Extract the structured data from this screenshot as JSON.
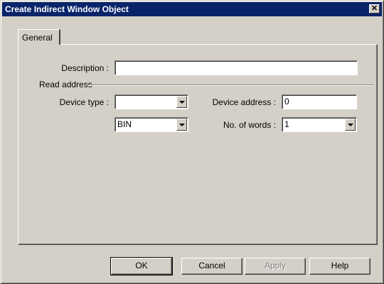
{
  "window": {
    "title": "Create Indirect Window Object",
    "close_glyph": "✕"
  },
  "tabs": [
    {
      "label": "General",
      "active": true
    }
  ],
  "form": {
    "description": {
      "label": "Description :",
      "value": ""
    },
    "read_address_group": "Read address",
    "device_type": {
      "label": "Device type :",
      "value": ""
    },
    "data_format": {
      "value": "BIN"
    },
    "device_address": {
      "label": "Device address :",
      "value": "0"
    },
    "no_of_words": {
      "label": "No. of words :",
      "value": "1"
    }
  },
  "buttons": {
    "ok": "OK",
    "cancel": "Cancel",
    "apply": {
      "label": "Apply",
      "disabled": true
    },
    "help": "Help"
  }
}
